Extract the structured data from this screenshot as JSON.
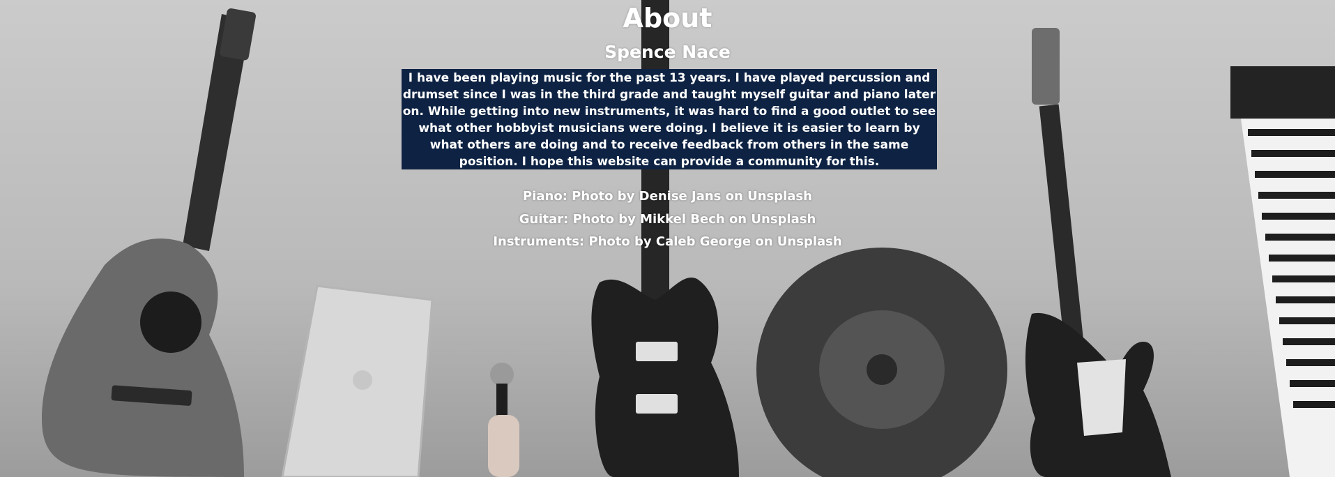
{
  "page": {
    "title": "About",
    "author": "Spence Nace",
    "bio": "I have been playing music for the past 13 years. I have played percussion and drumset since I was in the third grade and taught myself guitar and piano later on. While getting into new instruments, it was hard to find a good outlet to see what other hobbyist musicians were doing. I believe it is easier to learn by what others are doing and to receive feedback from others in the same position. I hope this website can provide a community for this."
  },
  "credits": [
    "Piano: Photo by Denise Jans on Unsplash",
    "Guitar: Photo by Mikkel Bech on Unsplash",
    "Instruments: Photo by Caleb George on Unsplash"
  ],
  "colors": {
    "bio_background": "#0e2343",
    "text": "#ffffff",
    "top_border": "#0e2343"
  }
}
